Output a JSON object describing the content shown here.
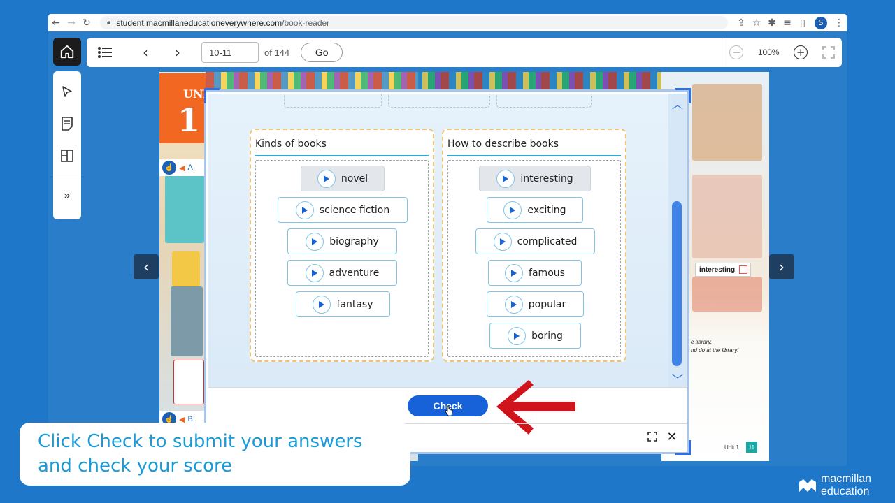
{
  "browser": {
    "url_domain": "student.macmillaneducationeverywhere.com",
    "url_path": "/book-reader",
    "profile_initial": "S"
  },
  "toolbar": {
    "page_value": "10-11",
    "page_total": "of 144",
    "go_label": "Go",
    "zoom": "100%"
  },
  "left_tools": {
    "expand_label": "»"
  },
  "book": {
    "unit_label": "UNIT",
    "unit_number": "1",
    "audio_a": "A",
    "audio_b": "B",
    "right_tag": "interesting",
    "right_text_1": "e library.",
    "right_text_2": "nd do at the library!",
    "footer_unit": "Unit 1",
    "footer_page": "11"
  },
  "activity": {
    "categories": [
      {
        "title": "Kinds of books",
        "words": [
          "novel",
          "science fiction",
          "biography",
          "adventure",
          "fantasy"
        ]
      },
      {
        "title": "How to describe books",
        "words": [
          "interesting",
          "exciting",
          "complicated",
          "famous",
          "popular",
          "boring"
        ]
      }
    ],
    "check_label": "Check"
  },
  "caption": {
    "line1": "Click Check to submit your answers",
    "line2": "and check your score"
  },
  "brand": {
    "line1": "macmillan",
    "line2": "education"
  },
  "colors": {
    "background": "#1f77c9",
    "accent_blue": "#1762d8",
    "caption_text": "#1a9bd8",
    "arrow_red": "#d0141e"
  }
}
